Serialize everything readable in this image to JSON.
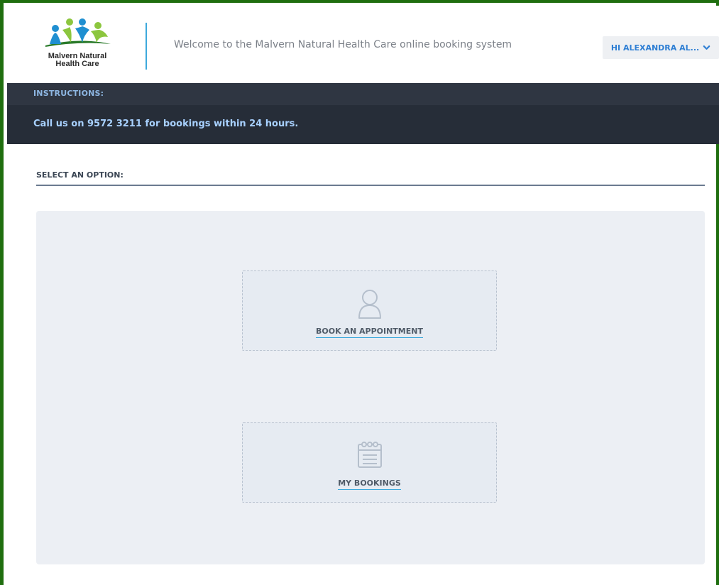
{
  "brand": {
    "name_line1": "Malvern Natural",
    "name_line2": "Health Care",
    "colors": {
      "accent": "#3da9dc",
      "green": "#8cc63e",
      "dark_green": "#2a7a2a",
      "blue": "#1f8fd1"
    }
  },
  "header": {
    "welcome": "Welcome to the Malvern Natural Health Care online booking system",
    "user_menu_label": "HI ALEXANDRA AL...",
    "user_menu_icon": "chevron-down-icon"
  },
  "instructions": {
    "title": "INSTRUCTIONS:",
    "message": "Call us on 9572 3211 for bookings within 24 hours."
  },
  "main": {
    "section_label": "SELECT AN OPTION:",
    "options": [
      {
        "label": "BOOK AN APPOINTMENT",
        "icon": "user-icon"
      },
      {
        "label": "MY BOOKINGS",
        "icon": "calendar-icon"
      }
    ]
  }
}
